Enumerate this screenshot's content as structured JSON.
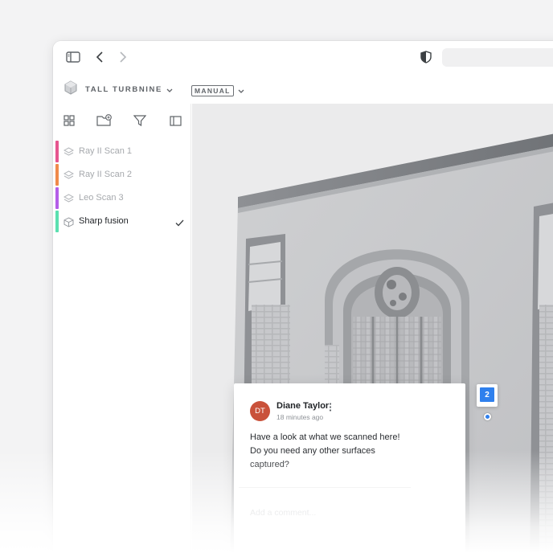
{
  "toolbar": {
    "project_name": "TALL TURBNINE",
    "mode_label": "MANUAL"
  },
  "sidebar": {
    "scans": [
      {
        "label": "Ray II Scan 1",
        "color": "#e6558f",
        "icon": "layers-icon",
        "active": false
      },
      {
        "label": "Ray II Scan 2",
        "color": "#f08a4b",
        "icon": "layers-icon",
        "active": false
      },
      {
        "label": "Leo Scan 3",
        "color": "#b45ee8",
        "icon": "layers-icon",
        "active": false
      },
      {
        "label": "Sharp fusion",
        "color": "#5be0b0",
        "icon": "cube-icon",
        "active": true
      }
    ]
  },
  "comment": {
    "avatar_initials": "DT",
    "avatar_color": "#c9513a",
    "author": "Diane Taylor",
    "time": "18 minutes ago",
    "message": "Have a look at what we scanned here! Do you need any other surfaces captured?",
    "reply_placeholder": "Add a comment..."
  },
  "pin": {
    "number": "2",
    "color": "#2f80ed"
  }
}
